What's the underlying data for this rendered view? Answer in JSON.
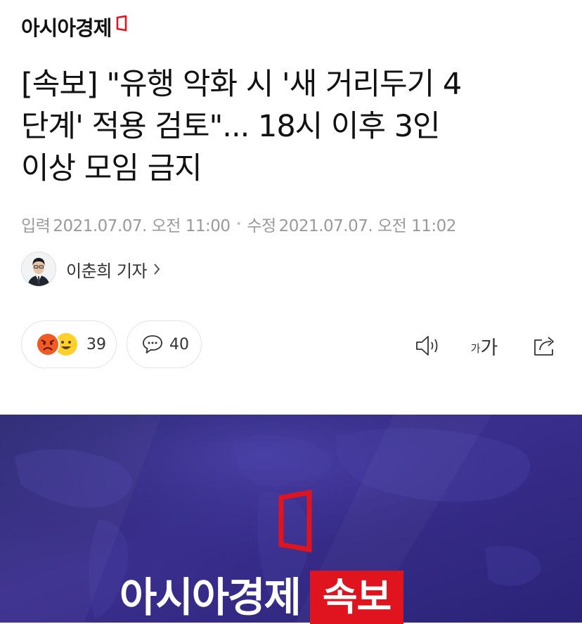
{
  "header": {
    "brand_name": "아시아경제"
  },
  "article": {
    "headline_lines": [
      "[속보] \"유행 악화 시 '새 거리두기 4",
      "단계' 적용 검토\"... 18시 이후 3인",
      "이상 모임 금지"
    ],
    "published_label": "입력",
    "published_value": "2021.07.07. 오전 11:00",
    "modified_label": "수정",
    "modified_value": "2021.07.07. 오전 11:02",
    "reporter": "이춘희 기자"
  },
  "actions": {
    "reaction_count": "39",
    "comment_count": "40",
    "font_size_label_small": "가",
    "font_size_label_large": "가"
  },
  "banner": {
    "brand": "아시아경제",
    "badge": "속보"
  },
  "colors": {
    "brand_red": "#e0141e",
    "banner_bg": "#2f2a80",
    "muted_text": "#9a9a9a"
  },
  "icons": [
    "brand-logo-mark",
    "chevron-right-icon",
    "angry-emoji-icon",
    "smile-emoji-icon",
    "comment-bubble-icon",
    "speaker-icon",
    "font-size-icon",
    "share-icon",
    "world-map-graphic"
  ]
}
